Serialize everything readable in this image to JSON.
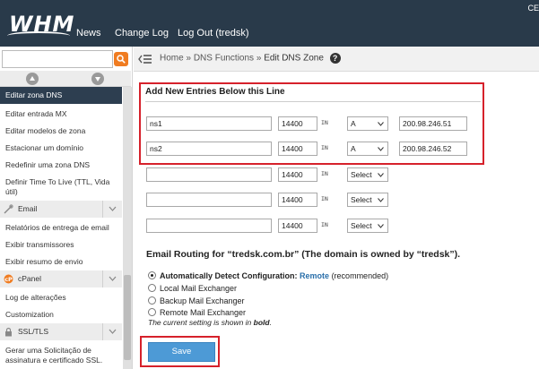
{
  "header": {
    "logo_text": "WHM",
    "nav": [
      "News",
      "Change Log",
      "Log Out (tredsk)"
    ],
    "right_text": "CE"
  },
  "sidebar": {
    "search_placeholder": "",
    "active_item": "Editar zona DNS",
    "items_dns": [
      "Editar entrada MX",
      "Editar modelos de zona",
      "Estacionar um domínio",
      "Redefinir uma zona DNS",
      "Definir Time To Live (TTL, Vida",
      "útil)"
    ],
    "section_email": "Email",
    "items_email": [
      "Relatórios de entrega de email",
      "Exibir transmissores",
      "Exibir resumo de envio"
    ],
    "section_cpanel": "cPanel",
    "items_cpanel": [
      "Log de alterações",
      "Customization"
    ],
    "section_ssl": "SSL/TLS",
    "items_ssl": [
      "Gerar uma Solicitação de",
      "assinatura e certificado SSL."
    ]
  },
  "breadcrumb": {
    "home": "Home",
    "sep": "»",
    "section": "DNS Functions",
    "current": "Edit DNS Zone",
    "help": "?"
  },
  "form": {
    "title": "Add New Entries Below this Line",
    "in_label": "IN",
    "rows": [
      {
        "name": "ns1",
        "ttl": "14400",
        "type": "A",
        "value": "200.98.246.51"
      },
      {
        "name": "ns2",
        "ttl": "14400",
        "type": "A",
        "value": "200.98.246.52"
      },
      {
        "name": "",
        "ttl": "14400",
        "type": "Select",
        "value": ""
      },
      {
        "name": "",
        "ttl": "14400",
        "type": "Select",
        "value": ""
      },
      {
        "name": "",
        "ttl": "14400",
        "type": "Select",
        "value": ""
      }
    ]
  },
  "email_routing": {
    "heading": "Email Routing for “tredsk.com.br” (The domain is owned by “tredsk”).",
    "opt_auto": "Automatically Detect Configuration:",
    "opt_auto_value": "Remote",
    "opt_auto_suffix": "(recommended)",
    "opt_local": "Local Mail Exchanger",
    "opt_backup": "Backup Mail Exchanger",
    "opt_remote": "Remote Mail Exchanger",
    "note_prefix": "The current setting is shown in",
    "note_bold": "bold",
    "note_suffix": "."
  },
  "save_label": "Save",
  "colors": {
    "header": "#293a4a",
    "accent": "#f07c21",
    "highlight": "#d6212b",
    "button": "#4d9ad6"
  }
}
